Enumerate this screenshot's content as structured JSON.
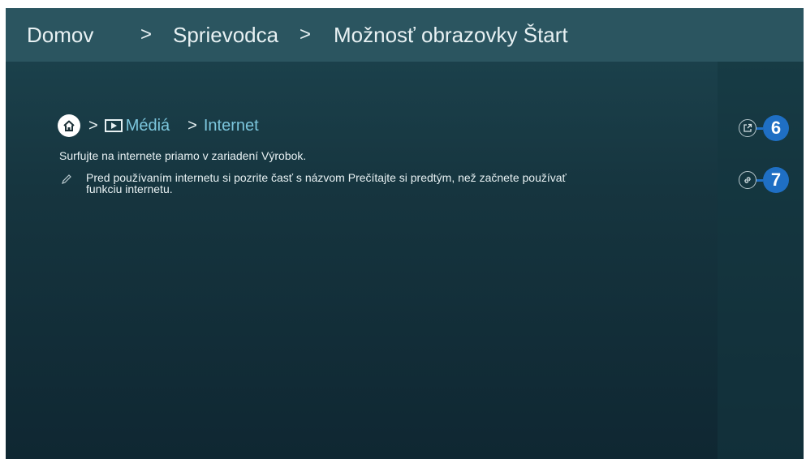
{
  "header": {
    "crumbs": [
      "Domov",
      "Sprievodca",
      "Možnosť obrazovky Štart"
    ],
    "separator": ">"
  },
  "path": {
    "separator": ">",
    "media_label": "Médiá",
    "internet_label": "Internet"
  },
  "content": {
    "description": "Surfujte na internete priamo v zariadení Výrobok.",
    "note": "Pred používaním internetu si pozrite časť s názvom Prečítajte si predtým, než začnete používať funkciu internetu."
  },
  "actions": [
    {
      "icon": "open-link-icon",
      "callout": "6"
    },
    {
      "icon": "link-icon",
      "callout": "7"
    }
  ],
  "colors": {
    "header_bg": "#2b5560",
    "background": "#16353f",
    "link": "#7cc6dd",
    "callout": "#1f6fc4"
  }
}
